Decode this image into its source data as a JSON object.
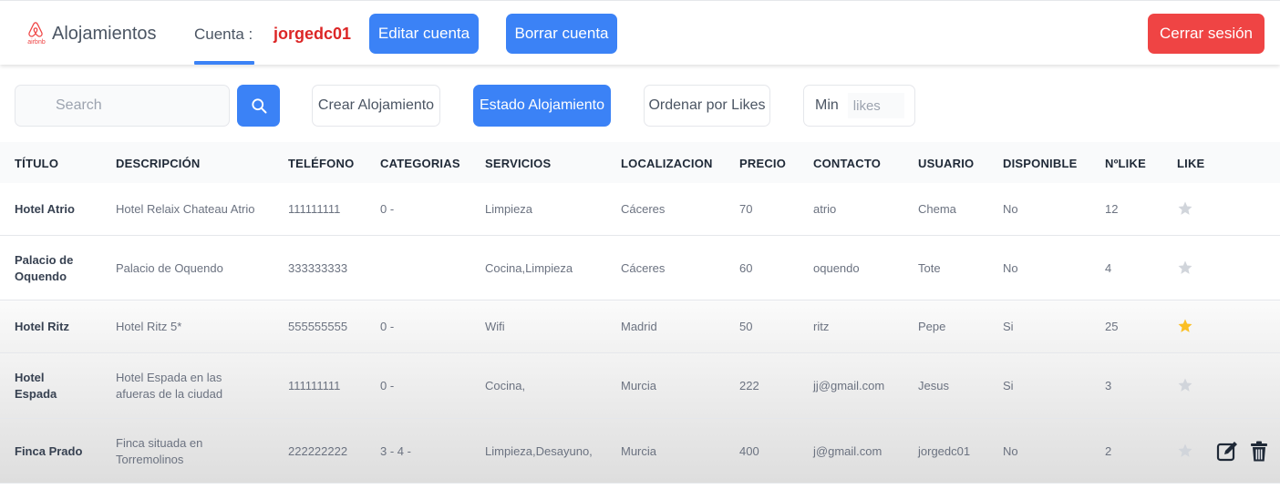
{
  "navbar": {
    "logo_text": "airbnb",
    "brand": "Alojamientos",
    "account_label": "Cuenta :",
    "username": "jorgedc01",
    "edit_button": "Editar cuenta",
    "delete_button": "Borrar cuenta",
    "logout_button": "Cerrar sesión"
  },
  "toolbar": {
    "search_placeholder": "Search",
    "search_icon": "search-icon",
    "create_button": "Crear Alojamiento",
    "status_button": "Estado Alojamiento",
    "sort_button": "Ordenar por Likes",
    "min_label": "Min",
    "likes_placeholder": "likes"
  },
  "table": {
    "headers": [
      "TÍTULO",
      "DESCRIPCIÓN",
      "TELÉFONO",
      "CATEGORIAS",
      "SERVICIOS",
      "LOCALIZACION",
      "PRECIO",
      "CONTACTO",
      "USUARIO",
      "DISPONIBLE",
      "NºLIKE",
      "LIKE"
    ],
    "rows": [
      {
        "titulo": [
          "Hotel Atrio"
        ],
        "descripcion": [
          "Hotel Relaix Chateau Atrio"
        ],
        "telefono": "111111111",
        "categorias": "0 -",
        "servicios": "Limpieza",
        "localizacion": "Cáceres",
        "precio": "70",
        "contacto": "atrio",
        "usuario": "Chema",
        "disponible": "No",
        "likes": "12",
        "liked": false,
        "owner": false
      },
      {
        "titulo": [
          "Palacio de",
          "Oquendo"
        ],
        "descripcion": [
          "Palacio de Oquendo"
        ],
        "telefono": "333333333",
        "categorias": "",
        "servicios": "Cocina,Limpieza",
        "localizacion": "Cáceres",
        "precio": "60",
        "contacto": "oquendo",
        "usuario": "Tote",
        "disponible": "No",
        "likes": "4",
        "liked": false,
        "owner": false
      },
      {
        "titulo": [
          "Hotel Ritz"
        ],
        "descripcion": [
          "Hotel Ritz 5*"
        ],
        "telefono": "555555555",
        "categorias": "0 -",
        "servicios": "Wifi",
        "localizacion": "Madrid",
        "precio": "50",
        "contacto": "ritz",
        "usuario": "Pepe",
        "disponible": "Si",
        "likes": "25",
        "liked": true,
        "owner": false
      },
      {
        "titulo": [
          "Hotel",
          "Espada"
        ],
        "descripcion": [
          "Hotel Espada en las",
          "afueras de la ciudad"
        ],
        "telefono": "111111111",
        "categorias": "0 -",
        "servicios": "Cocina,",
        "localizacion": "Murcia",
        "precio": "222",
        "contacto": "jj@gmail.com",
        "usuario": "Jesus",
        "disponible": "Si",
        "likes": "3",
        "liked": false,
        "owner": false
      },
      {
        "titulo": [
          "Finca Prado"
        ],
        "descripcion": [
          "Finca situada en",
          "Torremolinos"
        ],
        "telefono": "222222222",
        "categorias": "3 - 4 -",
        "servicios": "Limpieza,Desayuno,",
        "localizacion": "Murcia",
        "precio": "400",
        "contacto": "j@gmail.com",
        "usuario": "jorgedc01",
        "disponible": "No",
        "likes": "2",
        "liked": false,
        "owner": true
      }
    ]
  },
  "colors": {
    "primary": "#3b82f6",
    "danger": "#ef4444",
    "username": "#dc2626",
    "star_on": "#fbbf24",
    "star_off": "#d1d5db"
  }
}
